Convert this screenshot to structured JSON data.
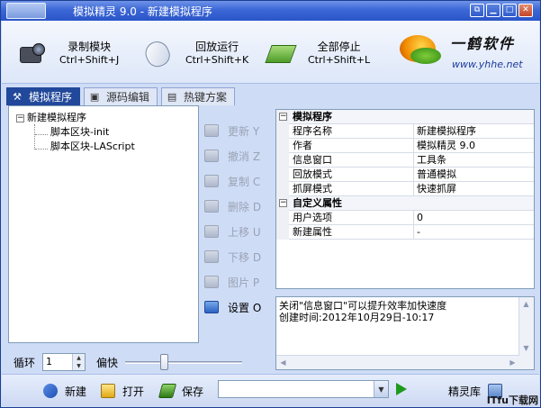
{
  "window": {
    "title": "模拟精灵 9.0 - 新建模拟程序",
    "controls": [
      "restore-icon",
      "minimize-icon",
      "maximize-icon",
      "close-icon"
    ]
  },
  "toolbar": {
    "items": [
      {
        "label": "录制模块",
        "shortcut": "Ctrl+Shift+J",
        "icon": "camcorder-icon"
      },
      {
        "label": "回放运行",
        "shortcut": "Ctrl+Shift+K",
        "icon": "mouse-icon"
      },
      {
        "label": "全部停止",
        "shortcut": "Ctrl+Shift+L",
        "icon": "book-icon"
      }
    ],
    "logo": {
      "text": "一鹤软件",
      "url": "www.yhhe.net"
    }
  },
  "tabs": [
    {
      "label": "模拟程序",
      "icon": "tools-icon",
      "active": true
    },
    {
      "label": "源码编辑",
      "icon": "code-icon",
      "active": false
    },
    {
      "label": "热键方案",
      "icon": "hotkey-icon",
      "active": false
    }
  ],
  "tree": {
    "root": "新建模拟程序",
    "toggle": "⊟",
    "children": [
      "脚本区块-init",
      "脚本区块-LAScript"
    ]
  },
  "actions": [
    {
      "label": "更新 Y",
      "enabled": false
    },
    {
      "label": "撤消 Z",
      "enabled": false
    },
    {
      "label": "复制 C",
      "enabled": false
    },
    {
      "label": "删除 D",
      "enabled": false
    },
    {
      "label": "上移 U",
      "enabled": false
    },
    {
      "label": "下移 D",
      "enabled": false
    },
    {
      "label": "图片 P",
      "enabled": false
    },
    {
      "label": "设置 O",
      "enabled": true
    }
  ],
  "properties": {
    "categories": [
      {
        "name": "模拟程序",
        "rows": [
          {
            "name": "程序名称",
            "value": "新建模拟程序"
          },
          {
            "name": "作者",
            "value": "模拟精灵 9.0"
          },
          {
            "name": "信息窗口",
            "value": "工具条"
          },
          {
            "name": "回放模式",
            "value": "普通模拟"
          },
          {
            "name": "抓屏模式",
            "value": "快速抓屏"
          }
        ]
      },
      {
        "name": "自定义属性",
        "rows": [
          {
            "name": "用户选项",
            "value": "0"
          },
          {
            "name": "新建属性",
            "value": "-"
          }
        ]
      }
    ]
  },
  "info": {
    "line1": "关闭\"信息窗口\"可以提升效率加快速度",
    "line2": "创建时间:2012年10月29日-10:17"
  },
  "loop": {
    "label": "循环",
    "value": "1",
    "speed_label": "偏快",
    "speed_level": 0.32
  },
  "bottom": {
    "new_label": "新建",
    "open_label": "打开",
    "save_label": "保存",
    "combo_value": "",
    "library_label": "精灵库"
  },
  "watermark": "ITfu下载网"
}
